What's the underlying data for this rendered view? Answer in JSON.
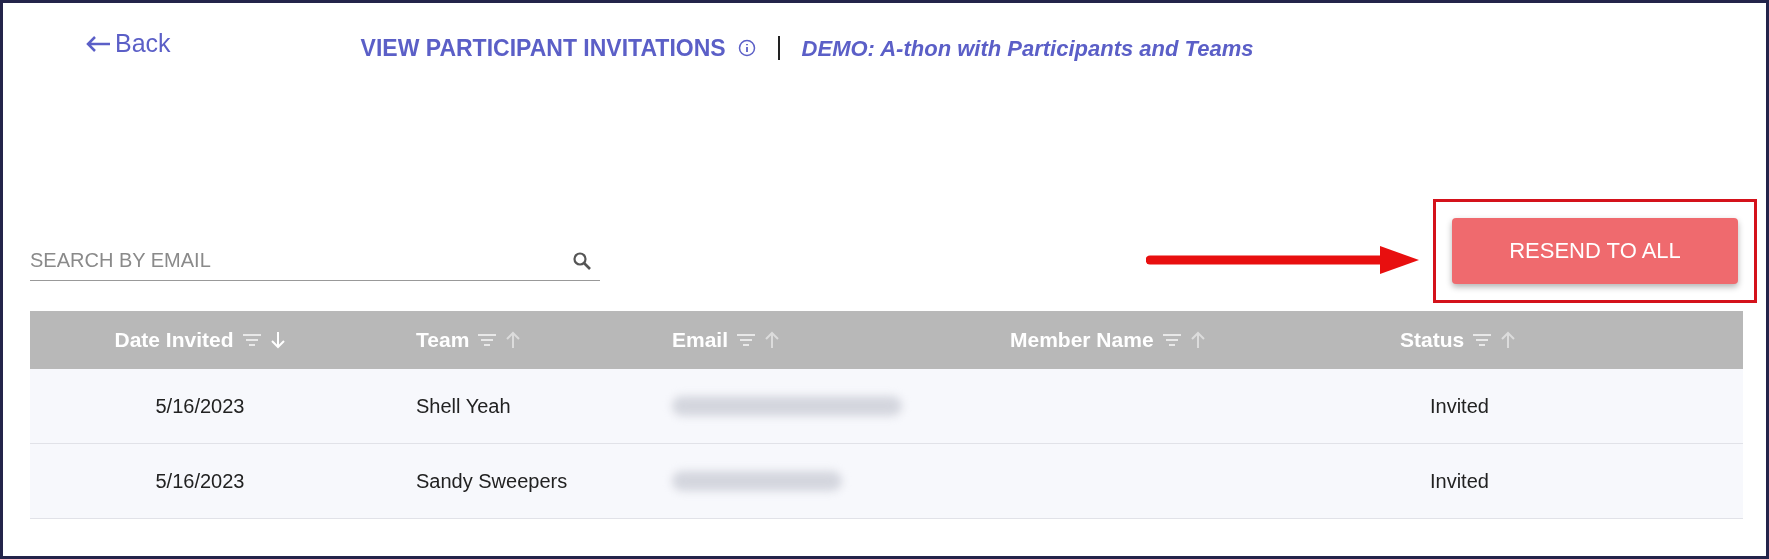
{
  "back": {
    "label": "Back"
  },
  "header": {
    "title": "VIEW PARTICIPANT INVITATIONS",
    "event": "DEMO: A-thon with Participants and Teams"
  },
  "search": {
    "placeholder": "SEARCH BY EMAIL"
  },
  "resend_button": {
    "label": "RESEND TO ALL",
    "highlighted": true
  },
  "table": {
    "columns": [
      {
        "label": "Date Invited",
        "sorted": true
      },
      {
        "label": "Team",
        "sorted": false
      },
      {
        "label": "Email",
        "sorted": false
      },
      {
        "label": "Member Name",
        "sorted": false
      },
      {
        "label": "Status",
        "sorted": false
      }
    ],
    "rows": [
      {
        "date": "5/16/2023",
        "team": "Shell Yeah",
        "email_blurred": true,
        "status": "Invited"
      },
      {
        "date": "5/16/2023",
        "team": "Sandy Sweepers",
        "email_blurred": true,
        "status": "Invited"
      }
    ]
  }
}
